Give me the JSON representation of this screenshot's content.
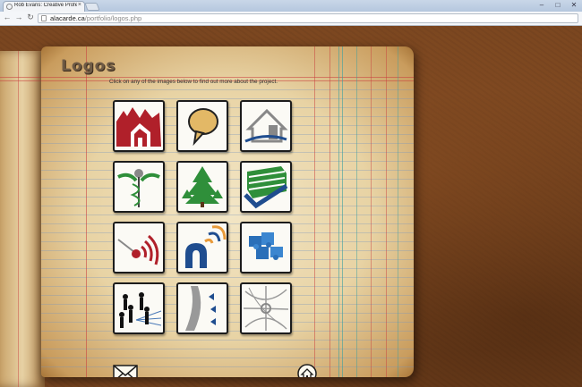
{
  "browser": {
    "tab_title": "Rob Evans: Creative Profes",
    "tab_close": "×",
    "url_host": "alacarde.ca",
    "url_path": "/portfolio/logos.php",
    "nav_back": "←",
    "nav_forward": "→",
    "nav_reload": "↻",
    "minimize": "–",
    "maximize": "□",
    "close": "✕"
  },
  "page": {
    "title": "Logos",
    "instruction": "Click on any of the images below to find out more about the project."
  },
  "tiles": [
    {
      "icon": "red-houses-logo"
    },
    {
      "icon": "speech-bubble-logo"
    },
    {
      "icon": "house-outline-logo"
    },
    {
      "icon": "caduceus-logo"
    },
    {
      "icon": "pine-trees-logo"
    },
    {
      "icon": "green-building-check-logo"
    },
    {
      "icon": "signal-dot-logo"
    },
    {
      "icon": "arch-wifi-logo"
    },
    {
      "icon": "puzzle-pieces-logo"
    },
    {
      "icon": "people-network-logo"
    },
    {
      "icon": "arrow-curve-logo"
    },
    {
      "icon": "star-web-logo"
    }
  ],
  "footer": {
    "mail_icon": "mail-envelope-icon",
    "home_icon": "home-icon"
  },
  "colors": {
    "book_paper": "#e8d3a4",
    "desk_brown": "#7a4620",
    "logo_red": "#b0202a",
    "logo_blue": "#1f4d8f",
    "logo_green": "#2f8f3a"
  }
}
